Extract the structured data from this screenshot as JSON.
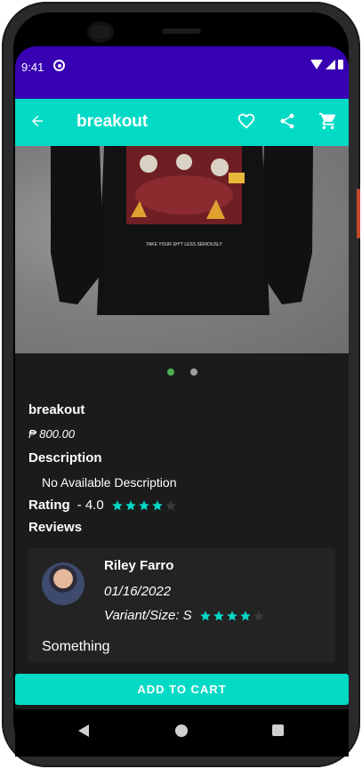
{
  "status_bar": {
    "time": "9:41",
    "sync_icon": "sync-circle-icon"
  },
  "app_bar": {
    "title": "breakout",
    "back_icon": "arrow-left-icon",
    "favorite_icon": "heart-outline-icon",
    "share_icon": "share-icon",
    "cart_icon": "cart-icon"
  },
  "product": {
    "image_caption": "TAKE YOUR SH*T LESS SERIOUSLY",
    "carousel": {
      "total": 2,
      "active_index": 0
    },
    "name": "breakout",
    "price": "₱ 800.00",
    "description_heading": "Description",
    "description": "No Available Description",
    "rating_label": "Rating",
    "rating_value": "- 4.0",
    "rating_stars": 4
  },
  "reviews": {
    "heading": "Reviews",
    "items": [
      {
        "name": "Riley Farro",
        "date": "01/16/2022",
        "variant": "Variant/Size: S",
        "stars": 4,
        "text": "Something"
      }
    ]
  },
  "actions": {
    "add_to_cart": "ADD TO CART"
  },
  "colors": {
    "accent": "#03dac5",
    "status_bar": "#3700b3",
    "background": "#1b1b1b",
    "star": "#03dac5",
    "dot_active": "#4caf50"
  }
}
